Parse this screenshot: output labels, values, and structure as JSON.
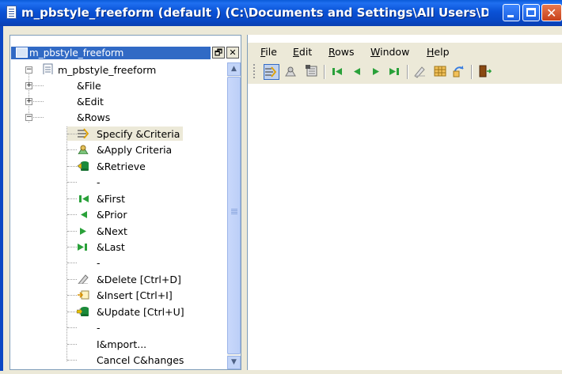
{
  "window": {
    "title": "m_pbstyle_freeform (default ) (C:\\Documents and Settings\\All Users\\D..."
  },
  "tree_panel": {
    "header_title": "m_pbstyle_freeform",
    "restore_glyph": "🗗",
    "close_glyph": "✕",
    "root": "m_pbstyle_freeform",
    "nodes": [
      {
        "label": "&File",
        "expander": "+"
      },
      {
        "label": "&Edit",
        "expander": "+"
      },
      {
        "label": "&Rows",
        "expander": "−"
      }
    ],
    "rows_children": [
      {
        "label": "Specify &Criteria",
        "icon": "specify-criteria-icon"
      },
      {
        "label": "&Apply Criteria",
        "icon": "apply-criteria-icon"
      },
      {
        "label": "&Retrieve",
        "icon": "retrieve-icon"
      },
      {
        "label": "-",
        "icon": ""
      },
      {
        "label": "&First",
        "icon": "first-icon"
      },
      {
        "label": "&Prior",
        "icon": "prior-icon"
      },
      {
        "label": "&Next",
        "icon": "next-icon"
      },
      {
        "label": "&Last",
        "icon": "last-icon"
      },
      {
        "label": "-",
        "icon": ""
      },
      {
        "label": "&Delete  [Ctrl+D]",
        "icon": "delete-icon"
      },
      {
        "label": "&Insert  [Ctrl+I]",
        "icon": "insert-icon"
      },
      {
        "label": "&Update  [Ctrl+U]",
        "icon": "update-icon"
      },
      {
        "label": "-",
        "icon": ""
      },
      {
        "label": "I&mport...",
        "icon": ""
      },
      {
        "label": "Cancel C&hanges",
        "icon": ""
      }
    ]
  },
  "menubar": {
    "items": [
      {
        "label": "File",
        "accel": "F",
        "rest": "ile"
      },
      {
        "label": "Edit",
        "accel": "E",
        "rest": "dit"
      },
      {
        "label": "Rows",
        "accel": "R",
        "rest": "ows"
      },
      {
        "label": "Window",
        "accel": "W",
        "rest": "indow"
      },
      {
        "label": "Help",
        "accel": "H",
        "rest": "elp"
      }
    ]
  },
  "toolbar": {
    "buttons": [
      "specify-criteria-icon",
      "apply-criteria-icon",
      "retrieve-icon",
      "first-icon",
      "prior-icon",
      "next-icon",
      "last-icon",
      "delete-icon",
      "insert-icon",
      "update-icon",
      "exit-icon"
    ]
  },
  "colors": {
    "titlebar": "#0a52d6",
    "selection": "#316ac5",
    "face": "#ece9d8",
    "green_nav": "#2aa13a"
  }
}
